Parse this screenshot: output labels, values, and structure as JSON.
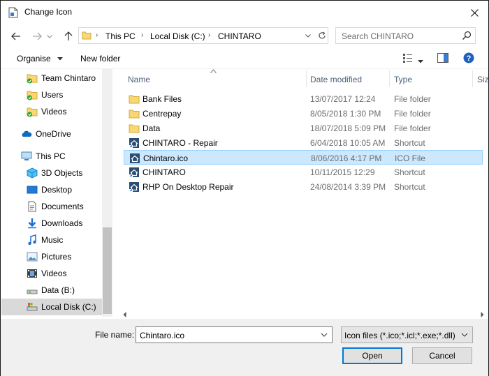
{
  "window": {
    "title": "Change Icon"
  },
  "address": {
    "crumbs": [
      "This PC",
      "Local Disk (C:)",
      "CHINTARO"
    ]
  },
  "search": {
    "placeholder": "Search CHINTARO"
  },
  "toolbar": {
    "organise": "Organise",
    "new_folder": "New folder"
  },
  "sidebar": {
    "items": [
      {
        "label": "Team Chintaro",
        "icon": "folder-sync-icon"
      },
      {
        "label": "Users",
        "icon": "folder-sync-icon"
      },
      {
        "label": "Videos",
        "icon": "folder-sync-icon"
      },
      {
        "label": "OneDrive",
        "icon": "cloud-icon"
      },
      {
        "label": "This PC",
        "icon": "computer-icon"
      },
      {
        "label": "3D Objects",
        "icon": "cube-icon"
      },
      {
        "label": "Desktop",
        "icon": "desktop-icon"
      },
      {
        "label": "Documents",
        "icon": "document-icon"
      },
      {
        "label": "Downloads",
        "icon": "download-icon"
      },
      {
        "label": "Music",
        "icon": "music-icon"
      },
      {
        "label": "Pictures",
        "icon": "pictures-icon"
      },
      {
        "label": "Videos",
        "icon": "video-icon"
      },
      {
        "label": "Data (B:)",
        "icon": "drive-icon"
      },
      {
        "label": "Local Disk (C:)",
        "icon": "system-drive-icon"
      }
    ]
  },
  "columns": {
    "name": "Name",
    "date": "Date modified",
    "type": "Type",
    "size": "Size"
  },
  "files": [
    {
      "name": "Bank Files",
      "date": "13/07/2017 12:24",
      "type": "File folder",
      "icon": "folder-icon"
    },
    {
      "name": "Centrepay",
      "date": "8/05/2018 1:30 PM",
      "type": "File folder",
      "icon": "folder-icon"
    },
    {
      "name": "Data",
      "date": "18/07/2018 5:09 PM",
      "type": "File folder",
      "icon": "folder-icon"
    },
    {
      "name": "CHINTARO - Repair",
      "date": "6/04/2018 10:05 AM",
      "type": "Shortcut",
      "icon": "shortcut-icon"
    },
    {
      "name": "Chintaro.ico",
      "date": "8/06/2016 4:17 PM",
      "type": "ICO File",
      "icon": "ico-file-icon"
    },
    {
      "name": "CHINTARO",
      "date": "10/11/2015 12:29",
      "type": "Shortcut",
      "icon": "shortcut-icon"
    },
    {
      "name": "RHP On Desktop Repair",
      "date": "24/08/2014 3:39 PM",
      "type": "Shortcut",
      "icon": "shortcut-icon"
    }
  ],
  "selected_file_index": 4,
  "file_name": {
    "label": "File name:",
    "value": "Chintaro.ico"
  },
  "file_type": {
    "value": "Icon files (*.ico;*.icl;*.exe;*.dll)"
  },
  "buttons": {
    "open": "Open",
    "cancel": "Cancel"
  },
  "colors": {
    "accent": "#0078d7",
    "selection": "#cce8ff",
    "folder": "#f8d775"
  }
}
